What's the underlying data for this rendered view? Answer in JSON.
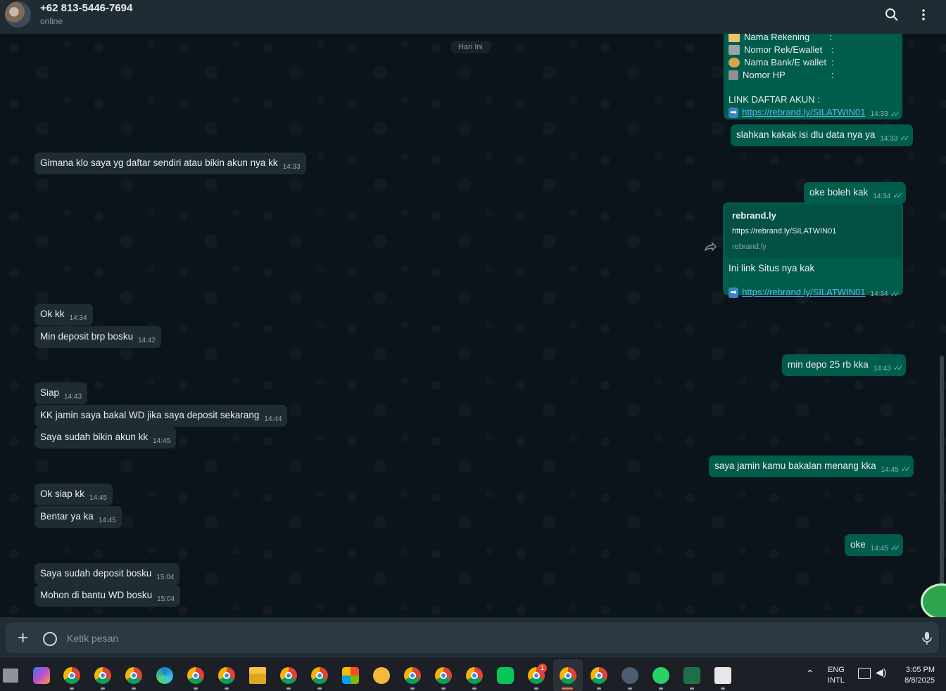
{
  "header": {
    "contact_name": "+62 813-5446-7694",
    "status": "online"
  },
  "chat": {
    "day_label": "Hari Ini",
    "card": {
      "lines": [
        {
          "label": "Nama Rekening",
          "sep": ":"
        },
        {
          "label": "Nomor Rek/Ewallet",
          "sep": ":"
        },
        {
          "label": "Nama Bank/E wallet",
          "sep": ":"
        },
        {
          "label": "Nomor HP",
          "sep": ":"
        }
      ],
      "link_heading": "LINK DAFTAR AKUN :",
      "link": "https://rebrand.ly/SILATWIN01",
      "time": "14:33"
    },
    "messages": [
      {
        "dir": "out",
        "text": "slahkan kakak isi dlu data nya ya",
        "time": "14:33"
      },
      {
        "dir": "in",
        "text": "Gimana klo saya yg daftar sendiri atau bikin akun nya kk",
        "time": "14:33"
      },
      {
        "dir": "out",
        "text": "oke boleh kak",
        "time": "14:34"
      },
      {
        "dir": "in",
        "text": "Ok kk",
        "time": "14:34"
      },
      {
        "dir": "in",
        "text": "Min deposit brp bosku",
        "time": "14:42"
      },
      {
        "dir": "out",
        "text": "min depo 25 rb kka",
        "time": "14:43"
      },
      {
        "dir": "in",
        "text": "Siap",
        "time": "14:43"
      },
      {
        "dir": "in",
        "text": "KK jamin saya bakal WD jika saya deposit sekarang",
        "time": "14:44"
      },
      {
        "dir": "in",
        "text": "Saya sudah bikin akun kk",
        "time": "14:45"
      },
      {
        "dir": "out",
        "text": "saya jamin kamu bakalan menang kka",
        "time": "14:45"
      },
      {
        "dir": "in",
        "text": "Ok siap kk",
        "time": "14:45"
      },
      {
        "dir": "in",
        "text": "Bentar ya ka",
        "time": "14:45"
      },
      {
        "dir": "out",
        "text": "oke",
        "time": "14:45"
      },
      {
        "dir": "in",
        "text": "Saya sudah deposit bosku",
        "time": "15:04"
      },
      {
        "dir": "in",
        "text": "Mohon di bantu WD bosku",
        "time": "15:04"
      }
    ],
    "link_message": {
      "preview_title": "rebrand.ly",
      "preview_url": "https://rebrand.ly/SILATWIN01",
      "preview_domain": "rebrand.ly",
      "text": "Ini link Situs nya kak",
      "link": "https://rebrand.ly/SILATWIN01",
      "time": "14:34"
    }
  },
  "composer": {
    "placeholder": "Ketik pesan"
  },
  "taskbar": {
    "lang_top": "ENG",
    "lang_bottom": "INTL",
    "time": "3:05 PM",
    "date": "8/8/2025",
    "badge": "1"
  },
  "colors": {
    "outgoing": "#005c4b",
    "incoming": "#202c33",
    "background": "#0b141a",
    "link": "#53bdeb"
  }
}
